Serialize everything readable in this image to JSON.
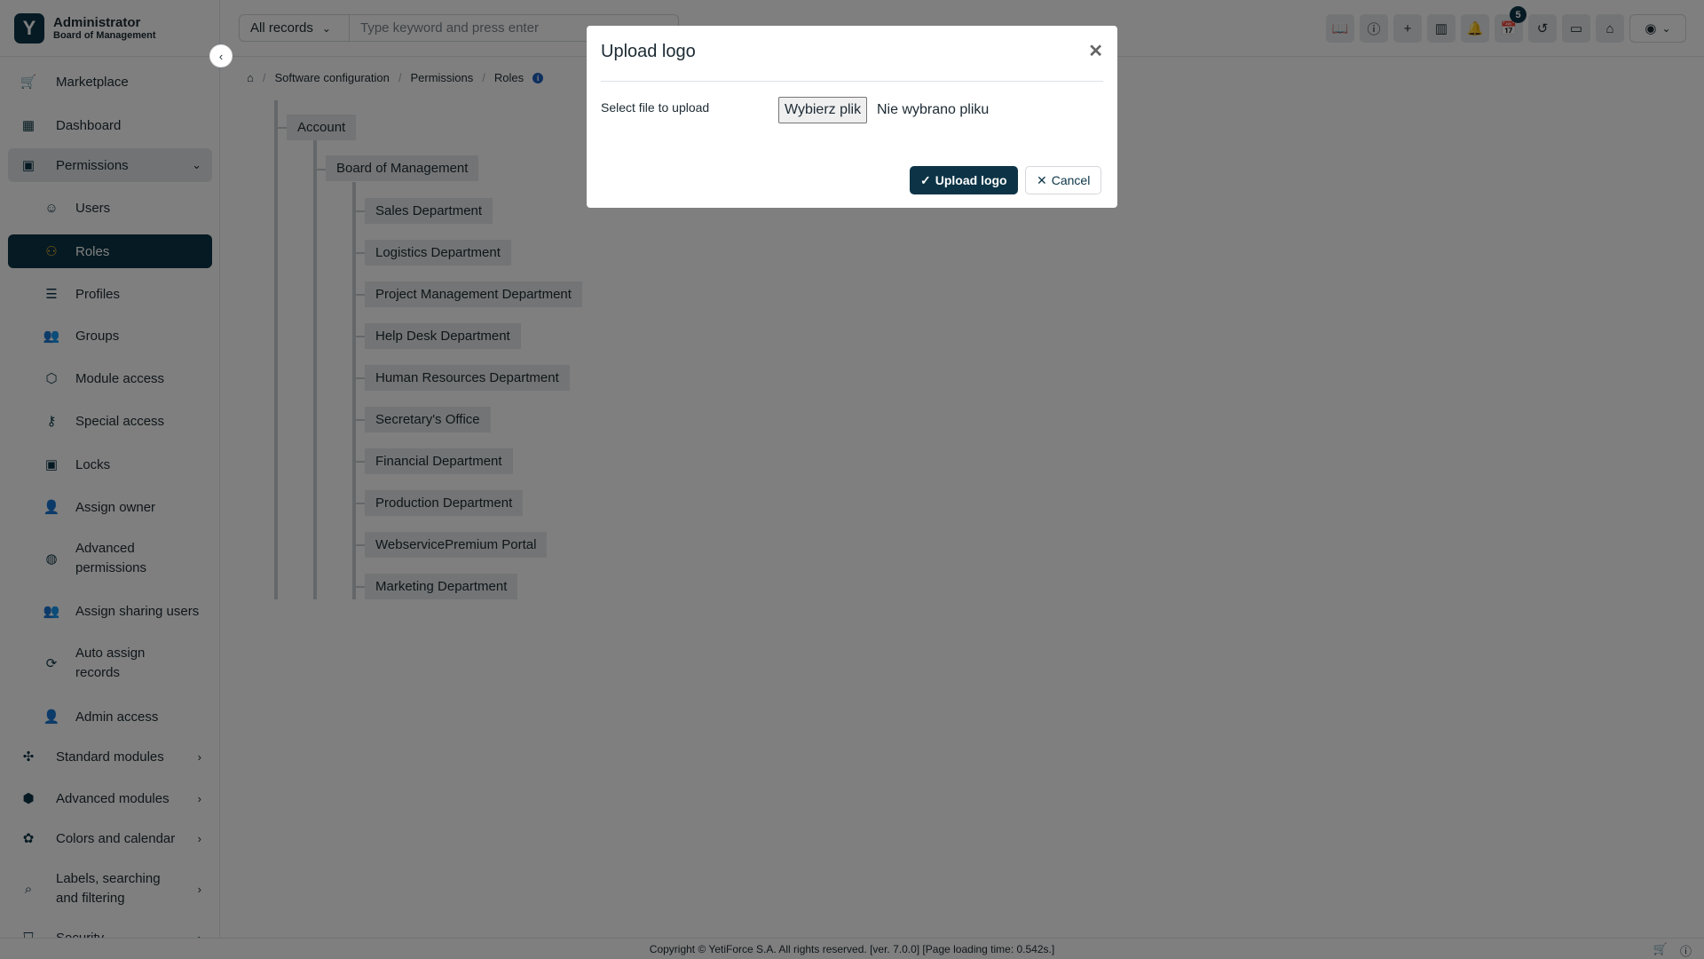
{
  "brand": {
    "name": "Administrator",
    "subtitle": "Board of Management"
  },
  "sidebar": {
    "items": [
      {
        "label": "Marketplace",
        "icon": "cart-icon",
        "glyph": "🛒",
        "type": "top"
      },
      {
        "label": "Dashboard",
        "icon": "dashboard-icon",
        "glyph": "▦",
        "type": "top"
      },
      {
        "label": "Permissions",
        "icon": "briefcase-icon",
        "glyph": "▣",
        "type": "top",
        "state": "open",
        "chev": "⌄"
      },
      {
        "label": "Users",
        "icon": "users-icon",
        "glyph": "☺",
        "type": "sub"
      },
      {
        "label": "Roles",
        "icon": "hierarchy-icon",
        "glyph": "⚇",
        "type": "sub",
        "state": "active"
      },
      {
        "label": "Profiles",
        "icon": "list-icon",
        "glyph": "☰",
        "type": "sub"
      },
      {
        "label": "Groups",
        "icon": "group-icon",
        "glyph": "👥",
        "type": "sub"
      },
      {
        "label": "Module access",
        "icon": "cube-icon",
        "glyph": "⬡",
        "type": "sub"
      },
      {
        "label": "Special access",
        "icon": "key-icon",
        "glyph": "⚷",
        "type": "sub"
      },
      {
        "label": "Locks",
        "icon": "lock-window-icon",
        "glyph": "▣",
        "type": "sub"
      },
      {
        "label": "Assign owner",
        "icon": "user-assign-icon",
        "glyph": "👤",
        "type": "sub"
      },
      {
        "label": "Advanced permissions",
        "icon": "fingerprint-icon",
        "glyph": "◍",
        "type": "sub",
        "lines": 2
      },
      {
        "label": "Assign sharing users",
        "icon": "sharing-users-icon",
        "glyph": "👥",
        "type": "sub"
      },
      {
        "label": "Auto assign records",
        "icon": "auto-assign-icon",
        "glyph": "⟳",
        "type": "sub",
        "lines": 2
      },
      {
        "label": "Admin access",
        "icon": "admin-lock-icon",
        "glyph": "👤",
        "type": "sub"
      },
      {
        "label": "Standard modules",
        "icon": "puzzle-icon",
        "glyph": "✣",
        "type": "top",
        "chev": "›"
      },
      {
        "label": "Advanced modules",
        "icon": "cubes-icon",
        "glyph": "⬢",
        "type": "top",
        "chev": "›"
      },
      {
        "label": "Colors and calendar",
        "icon": "palette-icon",
        "glyph": "✿",
        "type": "top",
        "chev": "›"
      },
      {
        "label": "Labels, searching and filtering",
        "icon": "search-list-icon",
        "glyph": "⌕",
        "type": "top",
        "chev": "›",
        "lines": 2
      },
      {
        "label": "Security",
        "icon": "shield-icon",
        "glyph": "⛉",
        "type": "top",
        "chev": "›"
      }
    ]
  },
  "header": {
    "search_select": "All records",
    "search_placeholder": "Type keyword and press enter",
    "calendar_badge": "5",
    "icons": [
      {
        "name": "book-icon",
        "glyph": "📖"
      },
      {
        "name": "info-icon",
        "glyph": "ⓘ"
      },
      {
        "name": "plus-icon",
        "glyph": "+"
      },
      {
        "name": "library-icon",
        "glyph": "▥"
      },
      {
        "name": "bell-icon",
        "glyph": "🔔"
      },
      {
        "name": "calendar-icon",
        "glyph": "📅"
      },
      {
        "name": "history-icon",
        "glyph": "↺"
      },
      {
        "name": "video-icon",
        "glyph": "▭"
      },
      {
        "name": "home-icon",
        "glyph": "⌂"
      }
    ]
  },
  "breadcrumb": [
    "Software configuration",
    "Permissions",
    "Roles"
  ],
  "tree": {
    "root": "Account",
    "level1": "Board of Management",
    "children": [
      "Sales Department",
      "Logistics Department",
      "Project Management Department",
      "Help Desk Department",
      "Human Resources Department",
      "Secretary's Office",
      "Financial Department",
      "Production Department",
      "WebservicePremium Portal",
      "Marketing Department"
    ]
  },
  "footer": {
    "text": "Copyright © YetiForce S.A. All rights reserved. [ver. 7.0.0] [Page loading time: 0.542s.]"
  },
  "modal": {
    "title": "Upload logo",
    "label": "Select file to upload",
    "file_button": "Wybierz plik",
    "file_status": "Nie wybrano pliku",
    "upload_label": "Upload logo",
    "cancel_label": "Cancel"
  },
  "colors": {
    "primary": "#0c3446",
    "active_icon": "#f0b429"
  }
}
